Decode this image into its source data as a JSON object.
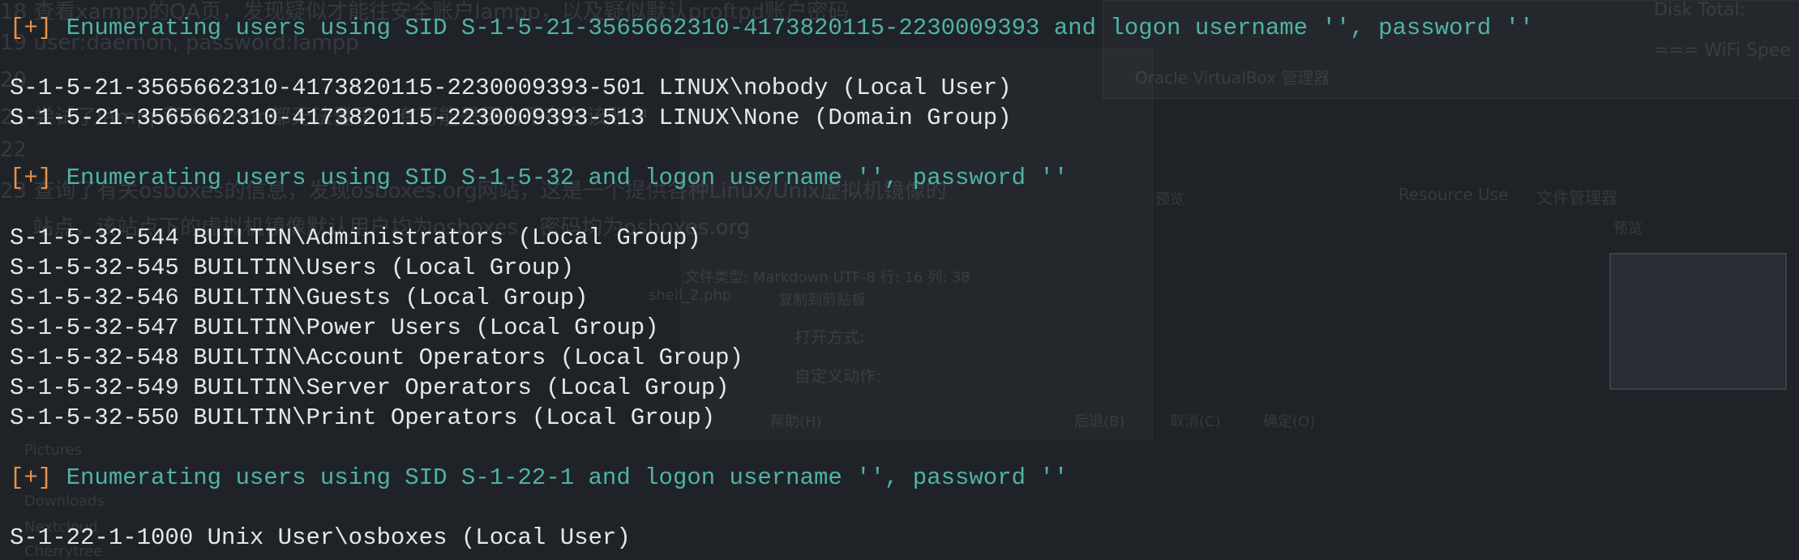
{
  "colors": {
    "background": "#1f2328",
    "text": "#e7e7e7",
    "info_marker": "#e6914a",
    "info_text": "#4fb3a6"
  },
  "terminal": {
    "lines": [
      {
        "kind": "info",
        "marker": "[+]",
        "text": "Enumerating users using SID S-1-5-21-3565662310-4173820115-2230009393 and logon username '', password ''"
      },
      {
        "kind": "blank",
        "text": ""
      },
      {
        "kind": "output",
        "text": "S-1-5-21-3565662310-4173820115-2230009393-501 LINUX\\nobody (Local User)"
      },
      {
        "kind": "output",
        "text": "S-1-5-21-3565662310-4173820115-2230009393-513 LINUX\\None (Domain Group)"
      },
      {
        "kind": "blank",
        "text": ""
      },
      {
        "kind": "info",
        "marker": "[+]",
        "text": "Enumerating users using SID S-1-5-32 and logon username '', password ''"
      },
      {
        "kind": "blank",
        "text": ""
      },
      {
        "kind": "output",
        "text": "S-1-5-32-544 BUILTIN\\Administrators (Local Group)"
      },
      {
        "kind": "output",
        "text": "S-1-5-32-545 BUILTIN\\Users (Local Group)"
      },
      {
        "kind": "output",
        "text": "S-1-5-32-546 BUILTIN\\Guests (Local Group)"
      },
      {
        "kind": "output",
        "text": "S-1-5-32-547 BUILTIN\\Power Users (Local Group)"
      },
      {
        "kind": "output",
        "text": "S-1-5-32-548 BUILTIN\\Account Operators (Local Group)"
      },
      {
        "kind": "output",
        "text": "S-1-5-32-549 BUILTIN\\Server Operators (Local Group)"
      },
      {
        "kind": "output",
        "text": "S-1-5-32-550 BUILTIN\\Print Operators (Local Group)"
      },
      {
        "kind": "blank",
        "text": ""
      },
      {
        "kind": "info",
        "marker": "[+]",
        "text": "Enumerating users using SID S-1-22-1 and logon username '', password ''"
      },
      {
        "kind": "blank",
        "text": ""
      },
      {
        "kind": "output",
        "text": "S-1-22-1-1000 Unix User\\osboxes (Local User)"
      }
    ]
  },
  "background_ghost": {
    "items": [
      "18 查看xampp的QA页，发现疑似才能往安全账户lampp，以及疑似默认proftpd账户密码",
      "19 user:daemon, password:lampp",
      "20",
      "21 尝试了lampp和daemon都无法登录，有可能是因为不存在该账户",
      "22",
      "23 查询了有关osboxes的信息，发现osboxes.org网站，这是一个提供各种Linux/Unix虚拟机镜像的",
      "站点，该站点下的虚拟机镜像默认用户均为osboxes，密码均为osboxes.org",
      "Oracle VirtualBox 管理器",
      "Disk Total:",
      "=== WiFi Spee",
      "Resource Use",
      "文件管理器",
      "预览",
      "预览",
      "文件类型: Markdown UTF-8 行: 16 列: 38",
      "shell_2.php",
      "复制到剪贴板",
      "打开方式:",
      "自定义动作:",
      "帮助(H)",
      "后退(B)",
      "取消(C)",
      "确定(O)",
      "Pictures",
      "Downloads",
      "Nextcloud",
      "Cherrytree"
    ]
  }
}
